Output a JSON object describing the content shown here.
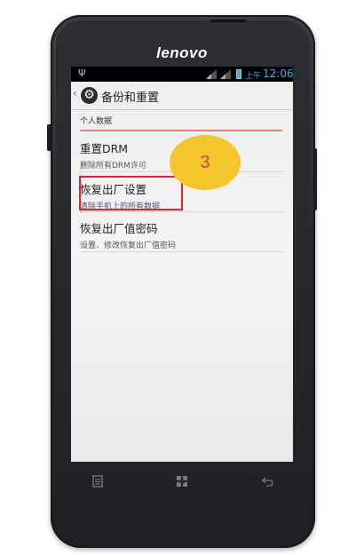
{
  "device": {
    "brand": "lenovo"
  },
  "status_bar": {
    "usb_icon": "usb-icon",
    "ampm": "上午",
    "time": "12:06",
    "accent": "#33b5e5"
  },
  "action_bar": {
    "back_icon": "chevron-left-icon",
    "settings_icon": "gear-icon",
    "title": "备份和重置"
  },
  "section": {
    "title": "个人数据",
    "accent": "#e0807a"
  },
  "items": [
    {
      "title": "重置DRM",
      "subtitle": "删除所有DRM许可"
    },
    {
      "title": "恢复出厂设置",
      "subtitle": "清除手机上的所有数据"
    },
    {
      "title": "恢复出厂值密码",
      "subtitle": "设置、修改恢复出厂值密码"
    }
  ],
  "callout": {
    "step": "3",
    "highlight_color": "#e0252b",
    "badge_color": "#f4c52d"
  },
  "nav": {
    "menu_icon": "menu-icon",
    "home_icon": "home-icon",
    "back_icon": "back-icon"
  }
}
